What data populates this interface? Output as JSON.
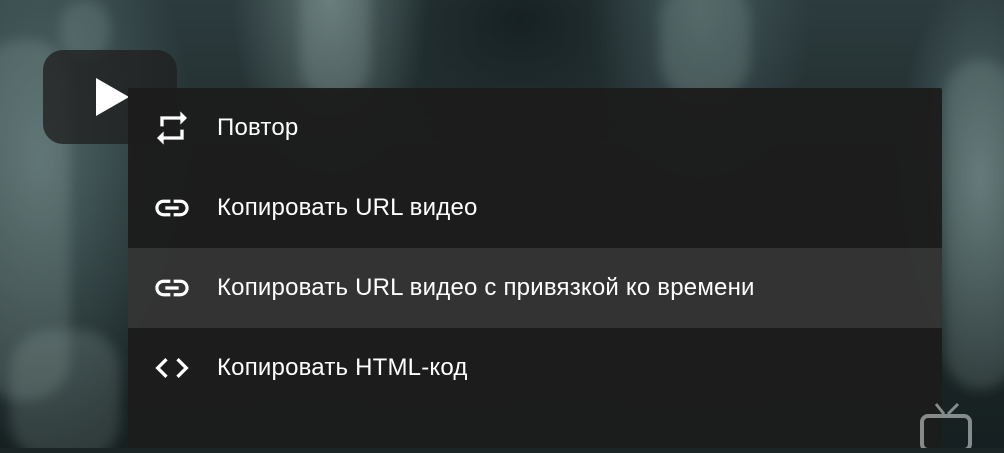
{
  "player": {
    "play_icon": "play-icon"
  },
  "context_menu": {
    "items": [
      {
        "label": "Повтор",
        "icon": "repeat-icon"
      },
      {
        "label": "Копировать URL видео",
        "icon": "link-icon"
      },
      {
        "label": "Копировать URL видео с привязкой ко времени",
        "icon": "link-icon",
        "highlighted": true
      },
      {
        "label": "Копировать HTML-код",
        "icon": "code-icon"
      }
    ]
  },
  "colors": {
    "menu_background": "#1c1c1c",
    "menu_text": "#ffffff",
    "highlight": "#3a3a3a"
  }
}
